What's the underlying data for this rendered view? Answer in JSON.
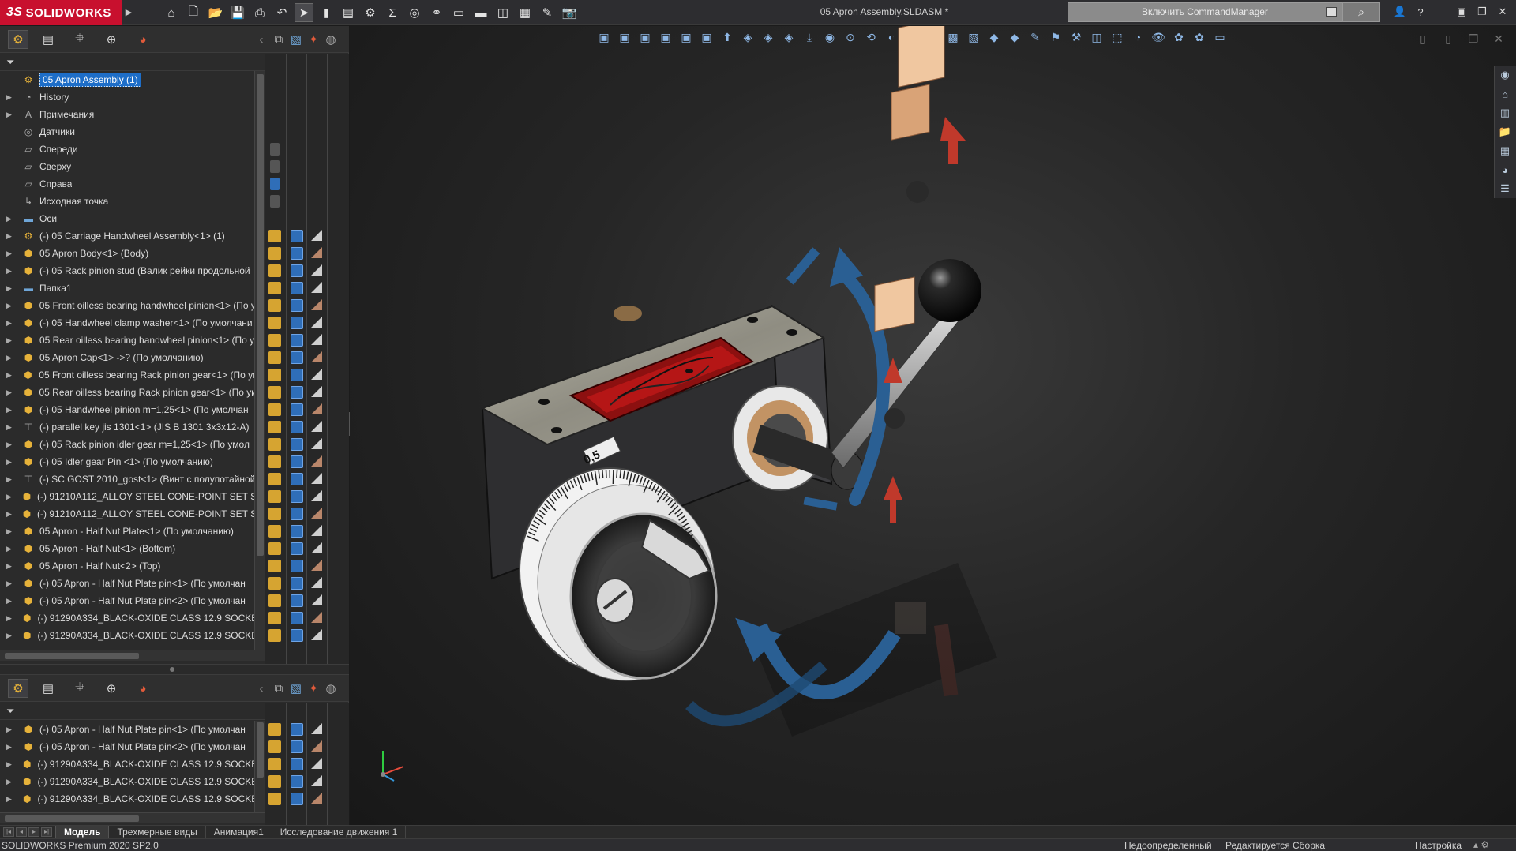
{
  "app": {
    "logo_text": "SOLIDWORKS",
    "document_title": "05 Apron Assembly.SLDASM *",
    "command_manager_label": "Включить CommandManager"
  },
  "tree_top": {
    "root": "05 Apron Assembly  (1)",
    "items": [
      {
        "label": "History",
        "icon": "history-icon",
        "expand": true
      },
      {
        "label": "Примечания",
        "icon": "annotations-icon",
        "expand": true
      },
      {
        "label": "Датчики",
        "icon": "sensors-icon",
        "expand": false
      },
      {
        "label": "Спереди",
        "icon": "plane-icon",
        "expand": false
      },
      {
        "label": "Сверху",
        "icon": "plane-icon",
        "expand": false
      },
      {
        "label": "Справа",
        "icon": "plane-icon",
        "expand": false
      },
      {
        "label": "Исходная точка",
        "icon": "origin-icon",
        "expand": false
      },
      {
        "label": "Оси",
        "icon": "folder-icon",
        "expand": true
      },
      {
        "label": "(-) 05 Carriage Handwheel Assembly<1> (1)",
        "icon": "assembly-icon",
        "expand": true
      },
      {
        "label": "05 Apron Body<1> (Body)",
        "icon": "part-icon",
        "expand": true
      },
      {
        "label": "(-) 05 Rack pinion stud (Валик рейки продольной",
        "icon": "part-icon",
        "expand": true
      },
      {
        "label": "Папка1",
        "icon": "folder-icon",
        "expand": true
      },
      {
        "label": "05 Front oilless bearing handwheel pinion<1> (По у",
        "icon": "part-icon",
        "expand": true
      },
      {
        "label": "(-) 05 Handwheel clamp washer<1> (По умолчани",
        "icon": "part-icon",
        "expand": true
      },
      {
        "label": "05 Rear oilless bearing handwheel pinion<1> (По у",
        "icon": "part-icon",
        "expand": true
      },
      {
        "label": "05 Apron Cap<1> ->? (По умолчанию)",
        "icon": "part-icon",
        "expand": true
      },
      {
        "label": "05 Front oilless bearing Rack pinion gear<1> (По ум",
        "icon": "part-icon",
        "expand": true
      },
      {
        "label": "05 Rear oilless bearing Rack pinion gear<1> (По ум",
        "icon": "part-icon",
        "expand": true
      },
      {
        "label": "(-) 05 Handwheel pinion m=1,25<1> (По умолчан",
        "icon": "part-icon",
        "expand": true
      },
      {
        "label": "(-) parallel key jis 1301<1> (JIS B 1301 3x3x12-A)",
        "icon": "toolbox-icon",
        "expand": true
      },
      {
        "label": "(-) 05 Rack pinion idler gear m=1,25<1> (По умол",
        "icon": "part-icon",
        "expand": true
      },
      {
        "label": "(-) 05 Idler gear Pin <1> (По умолчанию)",
        "icon": "part-icon",
        "expand": true
      },
      {
        "label": "(-) SC GOST 2010_gost<1> (Винт с полупотайной",
        "icon": "toolbox-icon",
        "expand": true
      },
      {
        "label": "(-) 91210A112_ALLOY STEEL CONE-POINT SET SCRE",
        "icon": "part-icon",
        "expand": true
      },
      {
        "label": "(-) 91210A112_ALLOY STEEL CONE-POINT SET SCRE",
        "icon": "part-icon",
        "expand": true
      },
      {
        "label": "05 Apron - Half Nut Plate<1> (По умолчанию)",
        "icon": "part-icon",
        "expand": true
      },
      {
        "label": "05 Apron - Half Nut<1> (Bottom)",
        "icon": "part-icon",
        "expand": true
      },
      {
        "label": "05 Apron - Half Nut<2> (Top)",
        "icon": "part-icon",
        "expand": true
      },
      {
        "label": "(-) 05 Apron - Half Nut Plate pin<1> (По умолчан",
        "icon": "part-icon",
        "expand": true
      },
      {
        "label": "(-) 05 Apron - Half Nut Plate pin<2> (По умолчан",
        "icon": "part-icon",
        "expand": true
      },
      {
        "label": "(-) 91290A334_BLACK-OXIDE CLASS 12.9 SOCKET H",
        "icon": "part-icon",
        "expand": true
      },
      {
        "label": "(-) 91290A334_BLACK-OXIDE CLASS 12.9 SOCKET H",
        "icon": "part-icon",
        "expand": true
      }
    ]
  },
  "tree_bottom": {
    "items": [
      {
        "label": "(-) 05 Apron - Half Nut Plate pin<1> (По умолчан",
        "icon": "part-icon"
      },
      {
        "label": "(-) 05 Apron - Half Nut Plate pin<2> (По умолчан",
        "icon": "part-icon"
      },
      {
        "label": "(-) 91290A334_BLACK-OXIDE CLASS 12.9 SOCKET H",
        "icon": "part-icon"
      },
      {
        "label": "(-) 91290A334_BLACK-OXIDE CLASS 12.9 SOCKET H",
        "icon": "part-icon"
      },
      {
        "label": "(-) 91290A334_BLACK-OXIDE CLASS 12.9 SOCKET H",
        "icon": "part-icon"
      }
    ]
  },
  "model": {
    "dial_label": "0,5"
  },
  "bottom_tabs": [
    "Модель",
    "Трехмерные виды",
    "Анимация1",
    "Исследование движения 1"
  ],
  "status": {
    "version": "SOLIDWORKS Premium 2020 SP2.0",
    "definition": "Недоопределенный",
    "editing": "Редактируется Сборка",
    "customize": "Настройка"
  },
  "colors": {
    "brand": "#c8102e",
    "selection": "#1e6ec8",
    "part_icon": "#e6b23a",
    "arrow_blue": "#2a5f93",
    "arrow_red": "#c0392b",
    "body_dark": "#2e2e30"
  }
}
